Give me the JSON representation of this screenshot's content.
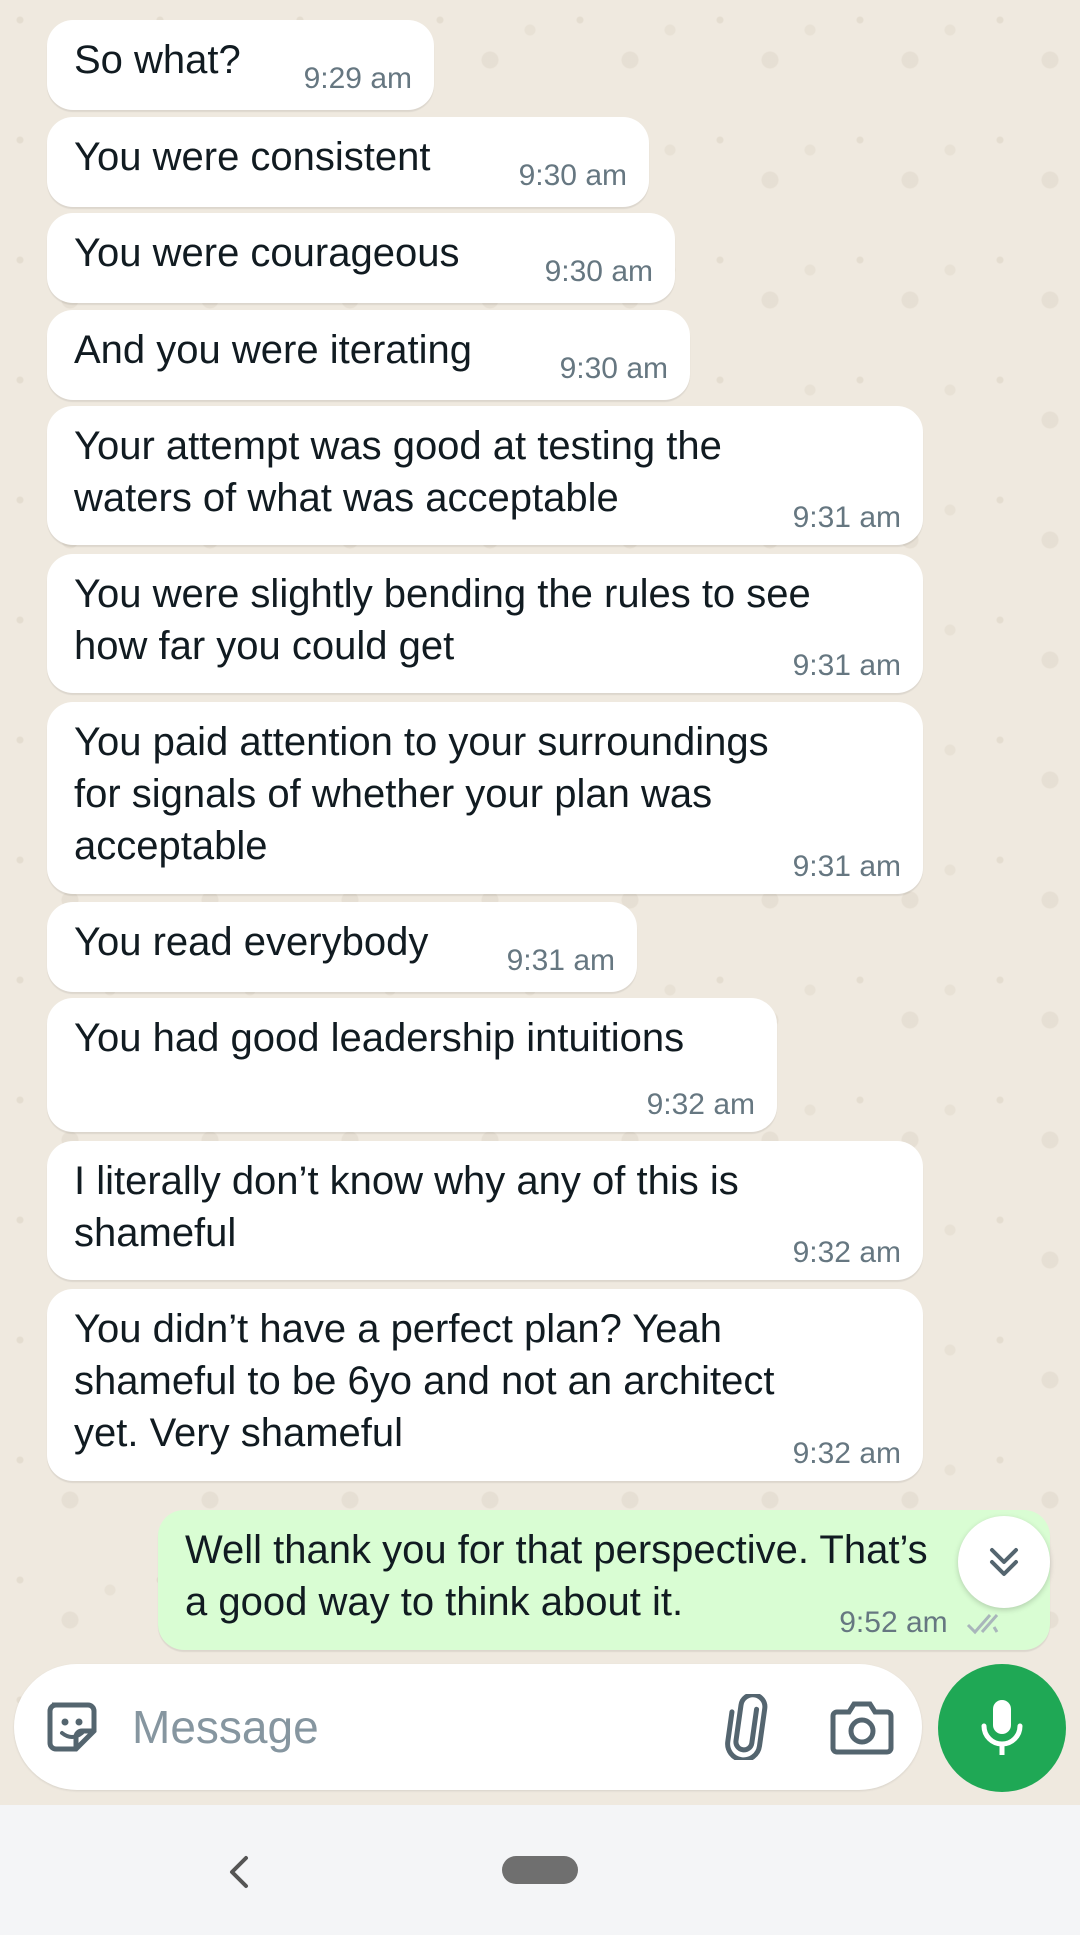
{
  "messages": [
    {
      "text": "So what?",
      "time": "9:29 am"
    },
    {
      "text": "You were consistent",
      "time": "9:30 am"
    },
    {
      "text": "You were courageous",
      "time": "9:30 am"
    },
    {
      "text": "And you were iterating",
      "time": "9:30 am"
    },
    {
      "text": "Your attempt was good at testing the\nwaters of what was acceptable",
      "time": "9:31 am"
    },
    {
      "text": "You were slightly bending the rules to see\nhow far you could get",
      "time": "9:31 am"
    },
    {
      "text": "You paid attention to your surroundings\nfor signals of whether your plan was\nacceptable",
      "time": "9:31 am"
    },
    {
      "text": "You read everybody",
      "time": "9:31 am"
    },
    {
      "text": "You had good leadership intuitions",
      "time": "9:32 am"
    },
    {
      "text": "I literally don’t know why any of this is\nshameful",
      "time": "9:32 am"
    },
    {
      "text": "You didn’t have a perfect plan? Yeah\nshameful to be 6yo and not an architect\nyet. Very shameful",
      "time": "9:32 am"
    },
    {
      "text": "Well thank you for that perspective. That’s\na good way to think about it.",
      "time": "9:52 am",
      "outgoing": true
    }
  ],
  "composer": {
    "placeholder": "Message"
  },
  "icons": {
    "emoji": "sticker-icon",
    "attach": "paperclip-icon",
    "camera": "camera-icon",
    "mic": "microphone-icon",
    "scroll": "double-chevron-down-icon",
    "read": "double-check-icon"
  },
  "colors": {
    "incoming_bubble": "#ffffff",
    "outgoing_bubble": "#d9fdd3",
    "mic_button": "#1fa855",
    "timestamp": "#667781"
  }
}
